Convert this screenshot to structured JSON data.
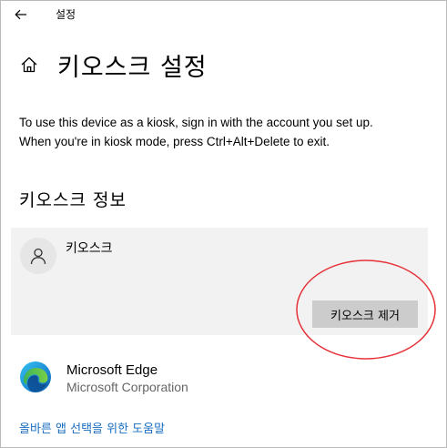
{
  "window": {
    "title": "설정",
    "back_icon": "back-arrow-icon"
  },
  "header": {
    "icon": "home-icon",
    "title": "키오스크 설정"
  },
  "description": {
    "line1": "To use this device as a kiosk, sign in with the account you set up.",
    "line2": "When you're in kiosk mode, press Ctrl+Alt+Delete to exit."
  },
  "kiosk_info": {
    "heading": "키오스크 정보",
    "account_name": "키오스크",
    "avatar_icon": "person-icon",
    "remove_button_label": "키오스크 제거"
  },
  "app": {
    "name": "Microsoft Edge",
    "publisher": "Microsoft Corporation",
    "icon": "microsoft-edge-icon"
  },
  "help_link": "올바른 앱 선택을 위한 도움말",
  "colors": {
    "card_background": "#f2f2f2",
    "button_background": "#cccccc",
    "link": "#1a6ec1",
    "annotation": "#e53238"
  }
}
